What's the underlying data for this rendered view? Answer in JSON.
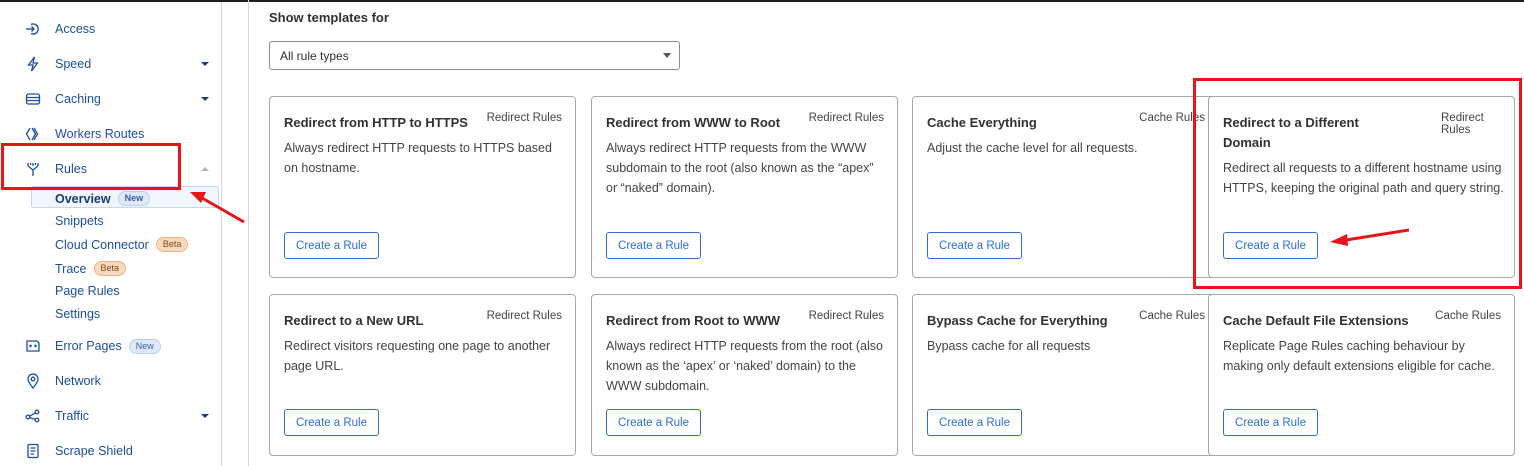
{
  "sidebar": {
    "items": [
      {
        "label": "Access",
        "icon": "access-icon"
      },
      {
        "label": "Speed",
        "icon": "lightning-icon"
      },
      {
        "label": "Caching",
        "icon": "caching-icon"
      },
      {
        "label": "Workers Routes",
        "icon": "workers-icon"
      },
      {
        "label": "Rules",
        "icon": "rules-icon"
      },
      {
        "label": "Error Pages",
        "icon": "error-pages-icon",
        "badge": "New"
      },
      {
        "label": "Network",
        "icon": "location-pin-icon"
      },
      {
        "label": "Traffic",
        "icon": "traffic-icon"
      },
      {
        "label": "Scrape Shield",
        "icon": "document-icon"
      }
    ],
    "rules_sub": [
      {
        "label": "Overview",
        "badge": "New",
        "active": true
      },
      {
        "label": "Snippets"
      },
      {
        "label": "Cloud Connector",
        "badge": "Beta"
      },
      {
        "label": "Trace",
        "badge": "Beta"
      },
      {
        "label": "Page Rules"
      },
      {
        "label": "Settings"
      }
    ]
  },
  "main": {
    "heading": "Show templates for",
    "filter": {
      "selected": "All rule types"
    },
    "create_label": "Create a Rule",
    "cards": [
      {
        "title": "Redirect from HTTP to HTTPS",
        "tag": "Redirect Rules",
        "desc": "Always redirect HTTP requests to HTTPS based on hostname."
      },
      {
        "title": "Redirect from WWW to Root",
        "tag": "Redirect Rules",
        "desc": "Always redirect HTTP requests from the WWW subdomain to the root (also known as the “apex” or “naked” domain)."
      },
      {
        "title": "Cache Everything",
        "tag": "Cache Rules",
        "desc": "Adjust the cache level for all requests."
      },
      {
        "title": "Redirect to a Different Domain",
        "tag": "Redirect Rules",
        "desc": "Redirect all requests to a different hostname using HTTPS, keeping the original path and query string."
      },
      {
        "title": "Redirect to a New URL",
        "tag": "Redirect Rules",
        "desc": "Redirect visitors requesting one page to another page URL."
      },
      {
        "title": "Redirect from Root to WWW",
        "tag": "Redirect Rules",
        "desc": "Always redirect HTTP requests from the root (also known as the ‘apex’ or ‘naked’ domain) to the WWW subdomain."
      },
      {
        "title": "Bypass Cache for Everything",
        "tag": "Cache Rules",
        "desc": "Bypass cache for all requests"
      },
      {
        "title": "Cache Default File Extensions",
        "tag": "Cache Rules",
        "desc": "Replicate Page Rules caching behaviour by making only default extensions eligible for cache."
      }
    ]
  },
  "colors": {
    "accent": "#2d6fcb",
    "nav_text": "#1e4f9c",
    "highlight": "#e8141a"
  }
}
